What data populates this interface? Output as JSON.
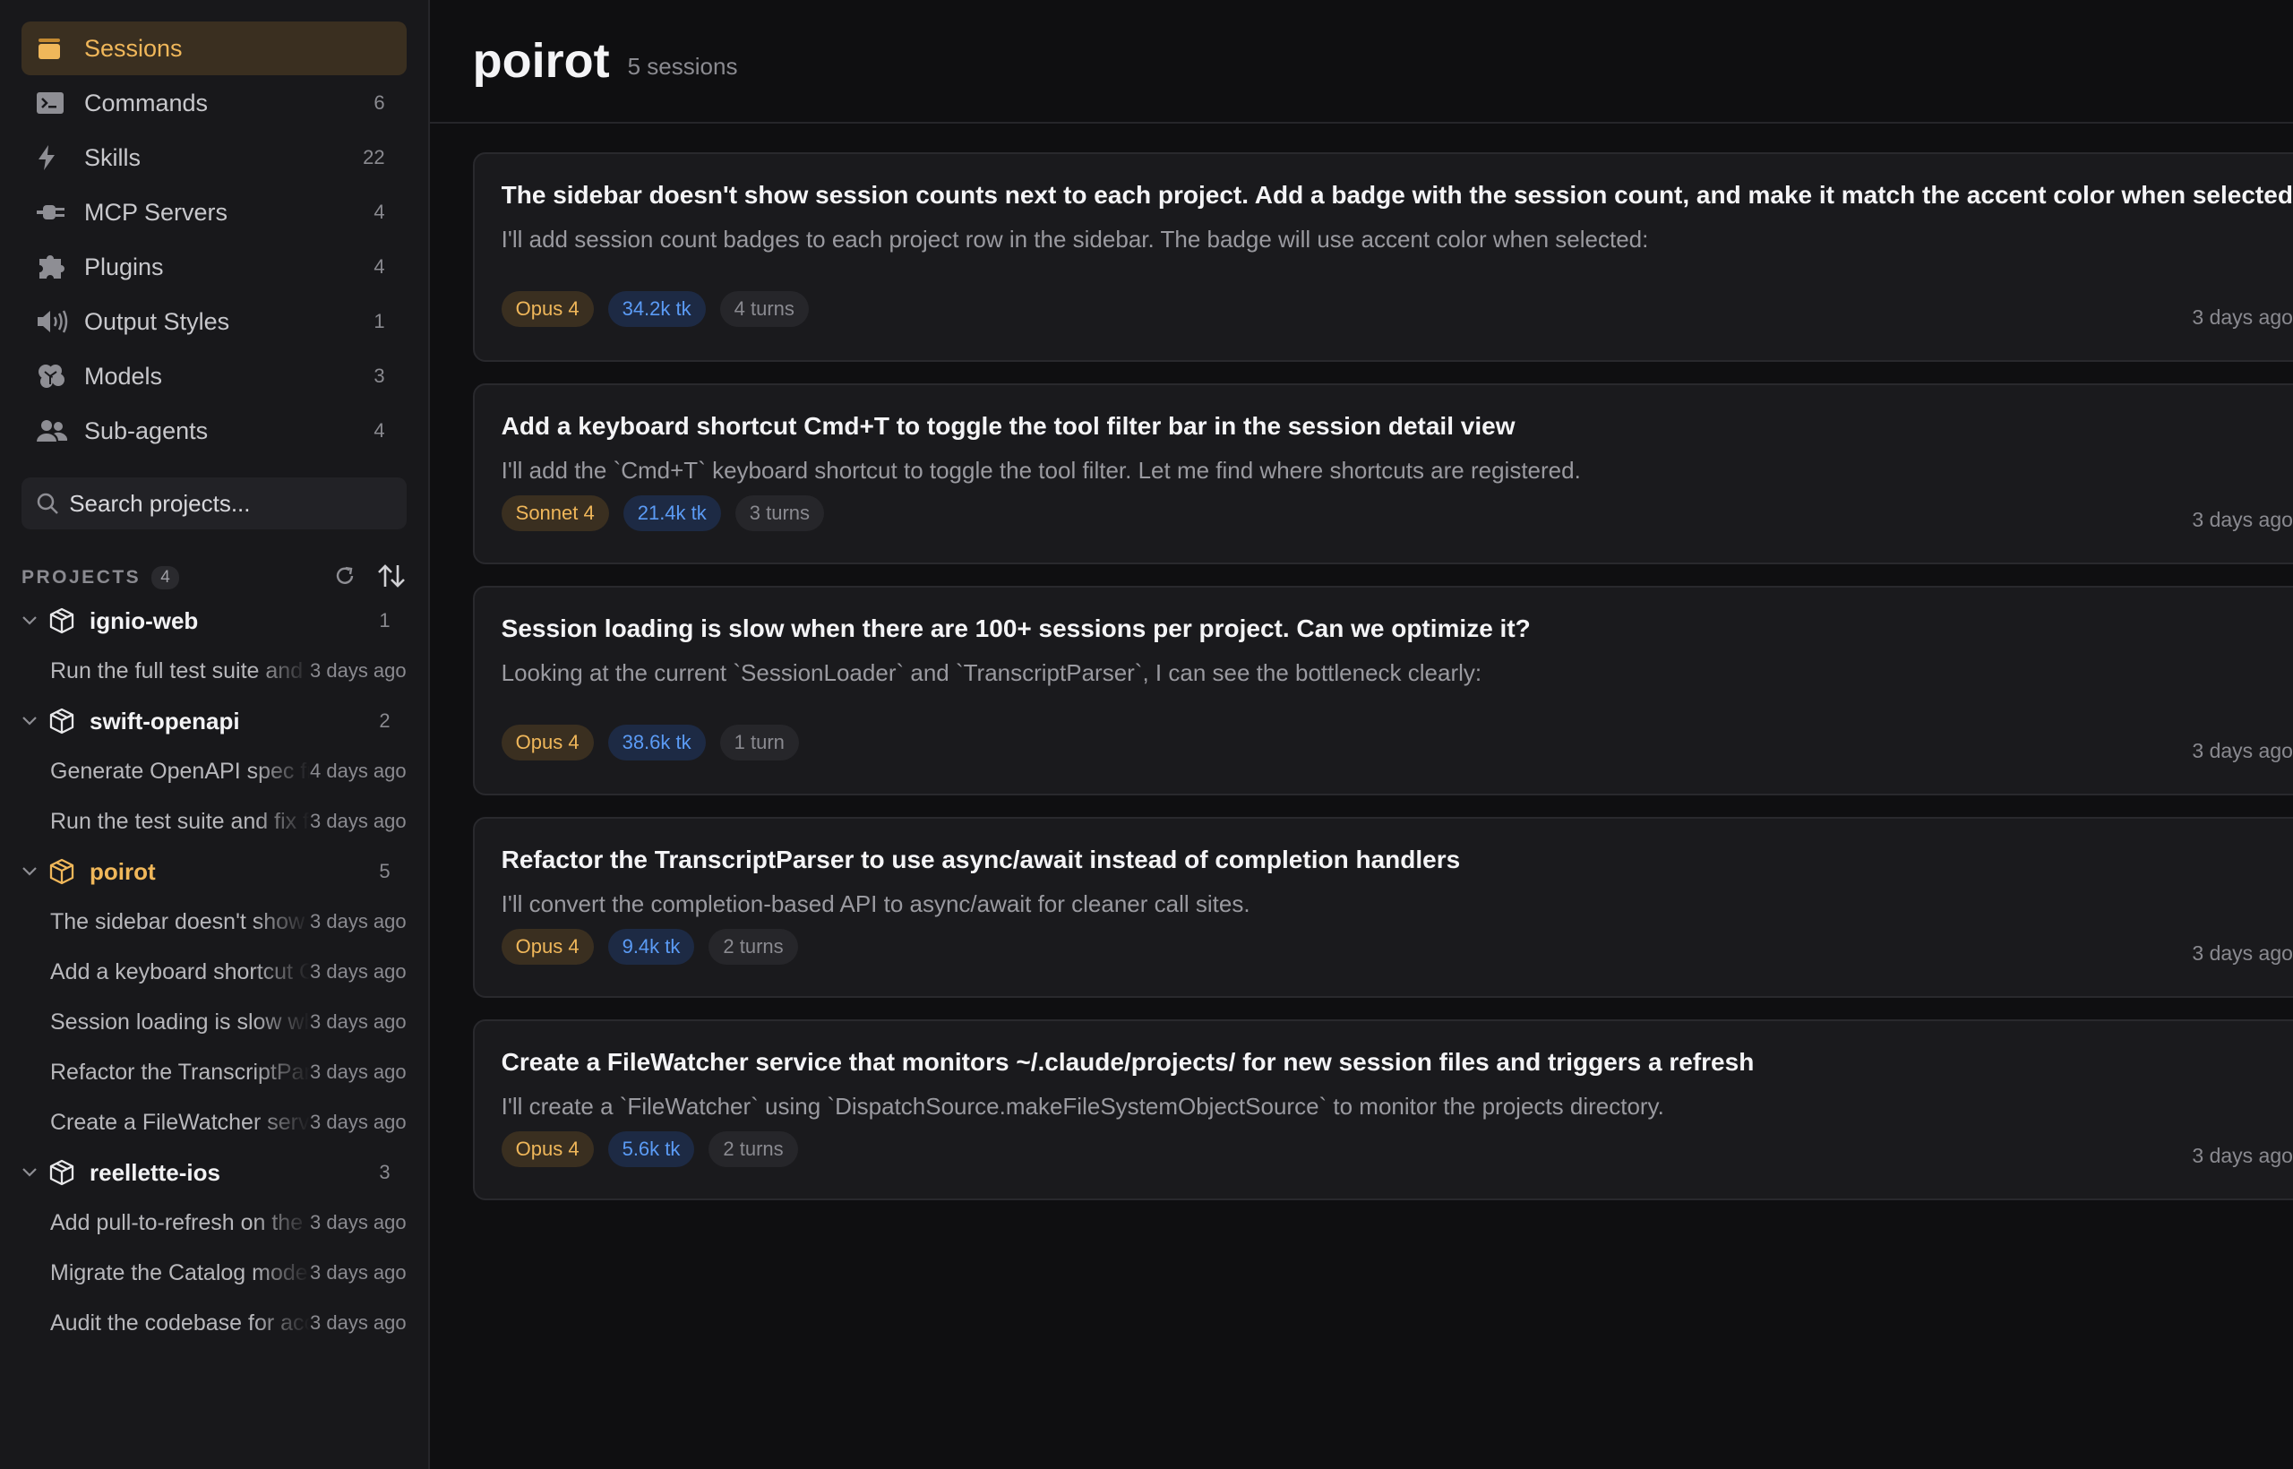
{
  "sidebar": {
    "nav": [
      {
        "label": "Sessions",
        "count": "",
        "icon": "sessions-icon",
        "active": true
      },
      {
        "label": "Commands",
        "count": "6",
        "icon": "terminal-icon"
      },
      {
        "label": "Skills",
        "count": "22",
        "icon": "bolt-icon"
      },
      {
        "label": "MCP Servers",
        "count": "4",
        "icon": "plug-icon"
      },
      {
        "label": "Plugins",
        "count": "4",
        "icon": "puzzle-icon"
      },
      {
        "label": "Output Styles",
        "count": "1",
        "icon": "speaker-icon"
      },
      {
        "label": "Models",
        "count": "3",
        "icon": "brain-icon"
      },
      {
        "label": "Sub-agents",
        "count": "4",
        "icon": "users-icon"
      }
    ],
    "search": {
      "placeholder": "Search projects..."
    },
    "projects_label": "PROJECTS",
    "projects_count": "4",
    "projects": [
      {
        "name": "ignio-web",
        "count": "1",
        "sessions": [
          {
            "title": "Run the full test suite and fix any failures",
            "time": "3 days ago"
          }
        ]
      },
      {
        "name": "swift-openapi",
        "count": "2",
        "sessions": [
          {
            "title": "Generate OpenAPI spec from the routes",
            "time": "4 days ago"
          },
          {
            "title": "Run the test suite and fix failures",
            "time": "3 days ago"
          }
        ]
      },
      {
        "name": "poirot",
        "count": "5",
        "selected": true,
        "sessions": [
          {
            "title": "The sidebar doesn't show session counts",
            "time": "3 days ago"
          },
          {
            "title": "Add a keyboard shortcut Cmd+T",
            "time": "3 days ago"
          },
          {
            "title": "Session loading is slow when there are",
            "time": "3 days ago"
          },
          {
            "title": "Refactor the TranscriptParser to use",
            "time": "3 days ago"
          },
          {
            "title": "Create a FileWatcher service that",
            "time": "3 days ago"
          }
        ]
      },
      {
        "name": "reellette-ios",
        "count": "3",
        "sessions": [
          {
            "title": "Add pull-to-refresh on the feed",
            "time": "3 days ago"
          },
          {
            "title": "Migrate the Catalog model",
            "time": "3 days ago"
          },
          {
            "title": "Audit the codebase for accessibility",
            "time": "3 days ago"
          }
        ]
      }
    ]
  },
  "main": {
    "title": "poirot",
    "subtitle": "5 sessions",
    "cards": [
      {
        "title": "The sidebar doesn't show session counts next to each project. Add a badge with the session count, and make it match the accent color when selected",
        "preview": "I'll add session count badges to each project row in the sidebar. The badge will use accent color when selected:",
        "model": "Opus 4",
        "tokens": "34.2k tk",
        "turns": "4 turns",
        "time": "3 days ago",
        "tall": true
      },
      {
        "title": "Add a keyboard shortcut Cmd+T to toggle the tool filter bar in the session detail view",
        "preview": "I'll add the `Cmd+T` keyboard shortcut to toggle the tool filter. Let me find where shortcuts are registered.",
        "model": "Sonnet 4",
        "tokens": "21.4k tk",
        "turns": "3 turns",
        "time": "3 days ago",
        "tall": false
      },
      {
        "title": "Session loading is slow when there are 100+ sessions per project. Can we optimize it?",
        "preview": "Looking at the current `SessionLoader` and `TranscriptParser`, I can see the bottleneck clearly:",
        "model": "Opus 4",
        "tokens": "38.6k tk",
        "turns": "1 turn",
        "time": "3 days ago",
        "tall": true
      },
      {
        "title": "Refactor the TranscriptParser to use async/await instead of completion handlers",
        "preview": "I'll convert the completion-based API to async/await for cleaner call sites.",
        "model": "Opus 4",
        "tokens": "9.4k tk",
        "turns": "2 turns",
        "time": "3 days ago",
        "tall": false
      },
      {
        "title": "Create a FileWatcher service that monitors ~/.claude/projects/ for new session files and triggers a refresh",
        "preview": "I'll create a `FileWatcher` using `DispatchSource.makeFileSystemObjectSource` to monitor the projects directory.",
        "model": "Opus 4",
        "tokens": "5.6k tk",
        "turns": "2 turns",
        "time": "3 days ago",
        "tall": false
      }
    ]
  },
  "colors": {
    "accent": "#f0b75a",
    "accent_bg": "#3a2f20",
    "token_blue": "#5b9bf5",
    "token_bg": "#1d2a44",
    "background": "#0f0f11",
    "sidebar_bg": "#18181b",
    "card_bg": "#1a1a1d"
  }
}
